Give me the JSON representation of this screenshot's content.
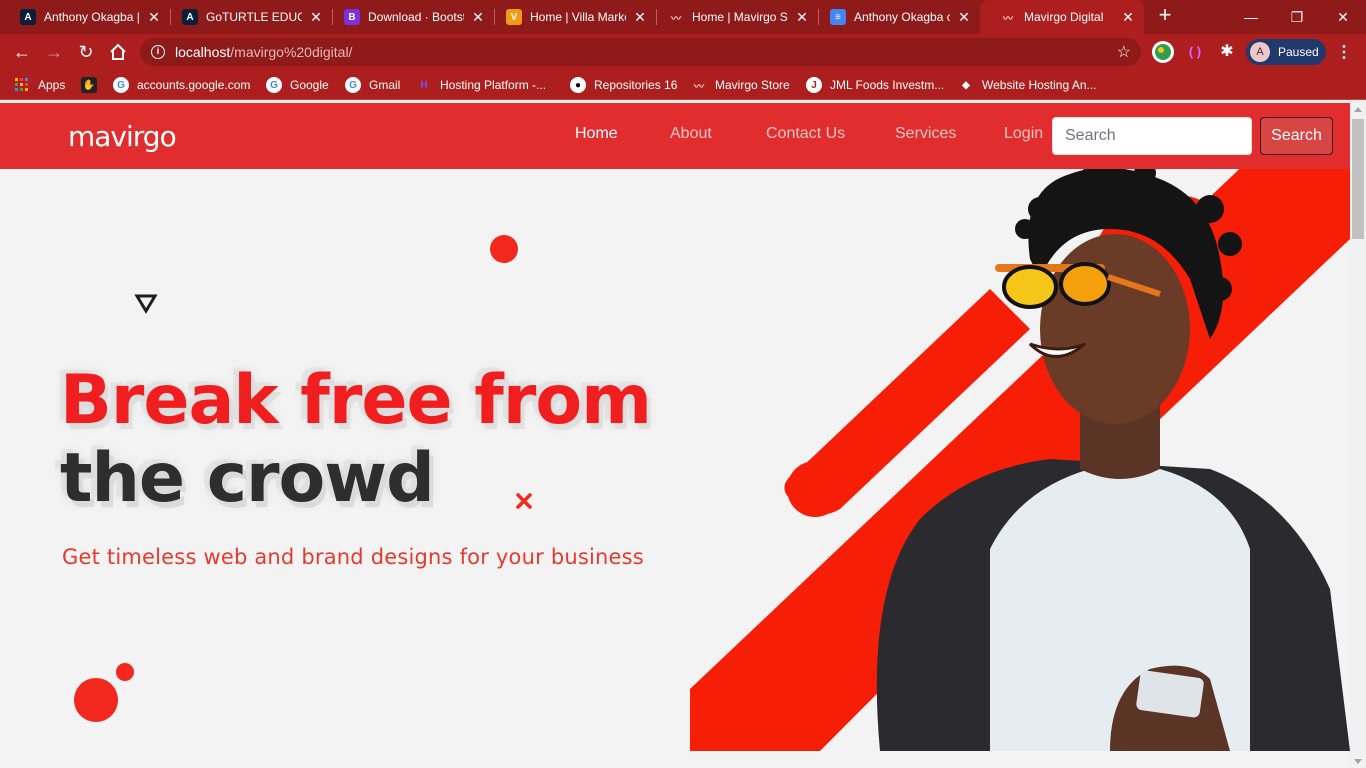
{
  "browser": {
    "tabs": [
      {
        "title": "Anthony Okagba |",
        "favicon": "angular-icon",
        "color": "#0b1f3a",
        "glyph": "A"
      },
      {
        "title": "GoTURTLE EDUCAT",
        "favicon": "angular-icon",
        "color": "#0b1f3a",
        "glyph": "A"
      },
      {
        "title": "Download · Bootst",
        "favicon": "bootstrap-icon",
        "color": "#7b2fe0",
        "glyph": "B"
      },
      {
        "title": "Home | Villa Marke",
        "favicon": "villa-icon",
        "color": "#f29a16",
        "glyph": "V"
      },
      {
        "title": "Home | Mavirgo St",
        "favicon": "mavirgo-icon",
        "color": "#e12d2d",
        "glyph": "~"
      },
      {
        "title": "Anthony Okagba c",
        "favicon": "google-docs-icon",
        "color": "#4285f4",
        "glyph": "≡"
      },
      {
        "title": "Mavirgo Digital",
        "favicon": "mavirgo-icon",
        "color": "#e12d2d",
        "glyph": "~"
      }
    ],
    "url_host": "localhost",
    "url_path": "/mavirgo%20digital/",
    "profile_initial": "A",
    "profile_status": "Paused",
    "bookmarks": [
      {
        "label": "Apps",
        "icon": "apps-grid-icon"
      },
      {
        "label": "",
        "icon": "hand-icon"
      },
      {
        "label": "accounts.google.com",
        "icon": "google-icon"
      },
      {
        "label": "Google",
        "icon": "google-icon"
      },
      {
        "label": "Gmail",
        "icon": "google-icon"
      },
      {
        "label": "Hosting Platform -...",
        "icon": "hosting-icon"
      },
      {
        "label": "Repositories 16",
        "icon": "github-icon"
      },
      {
        "label": "Mavirgo Store",
        "icon": "mavirgo-icon"
      },
      {
        "label": "JML Foods Investm...",
        "icon": "jml-icon"
      },
      {
        "label": "Website Hosting An...",
        "icon": "hosting-diamond-icon"
      }
    ]
  },
  "site": {
    "logo": "mavirgo",
    "nav": [
      "Home",
      "About",
      "Contact Us",
      "Services",
      "Login"
    ],
    "search_placeholder": "Search",
    "search_button": "Search",
    "headline_line1": "Break free from",
    "headline_line2": "the crowd",
    "subheadline": "Get timeless web and brand designs for your business",
    "colors": {
      "brand": "#e12d2d",
      "accent": "#f01e1e",
      "dark": "#2e2e2e"
    }
  }
}
